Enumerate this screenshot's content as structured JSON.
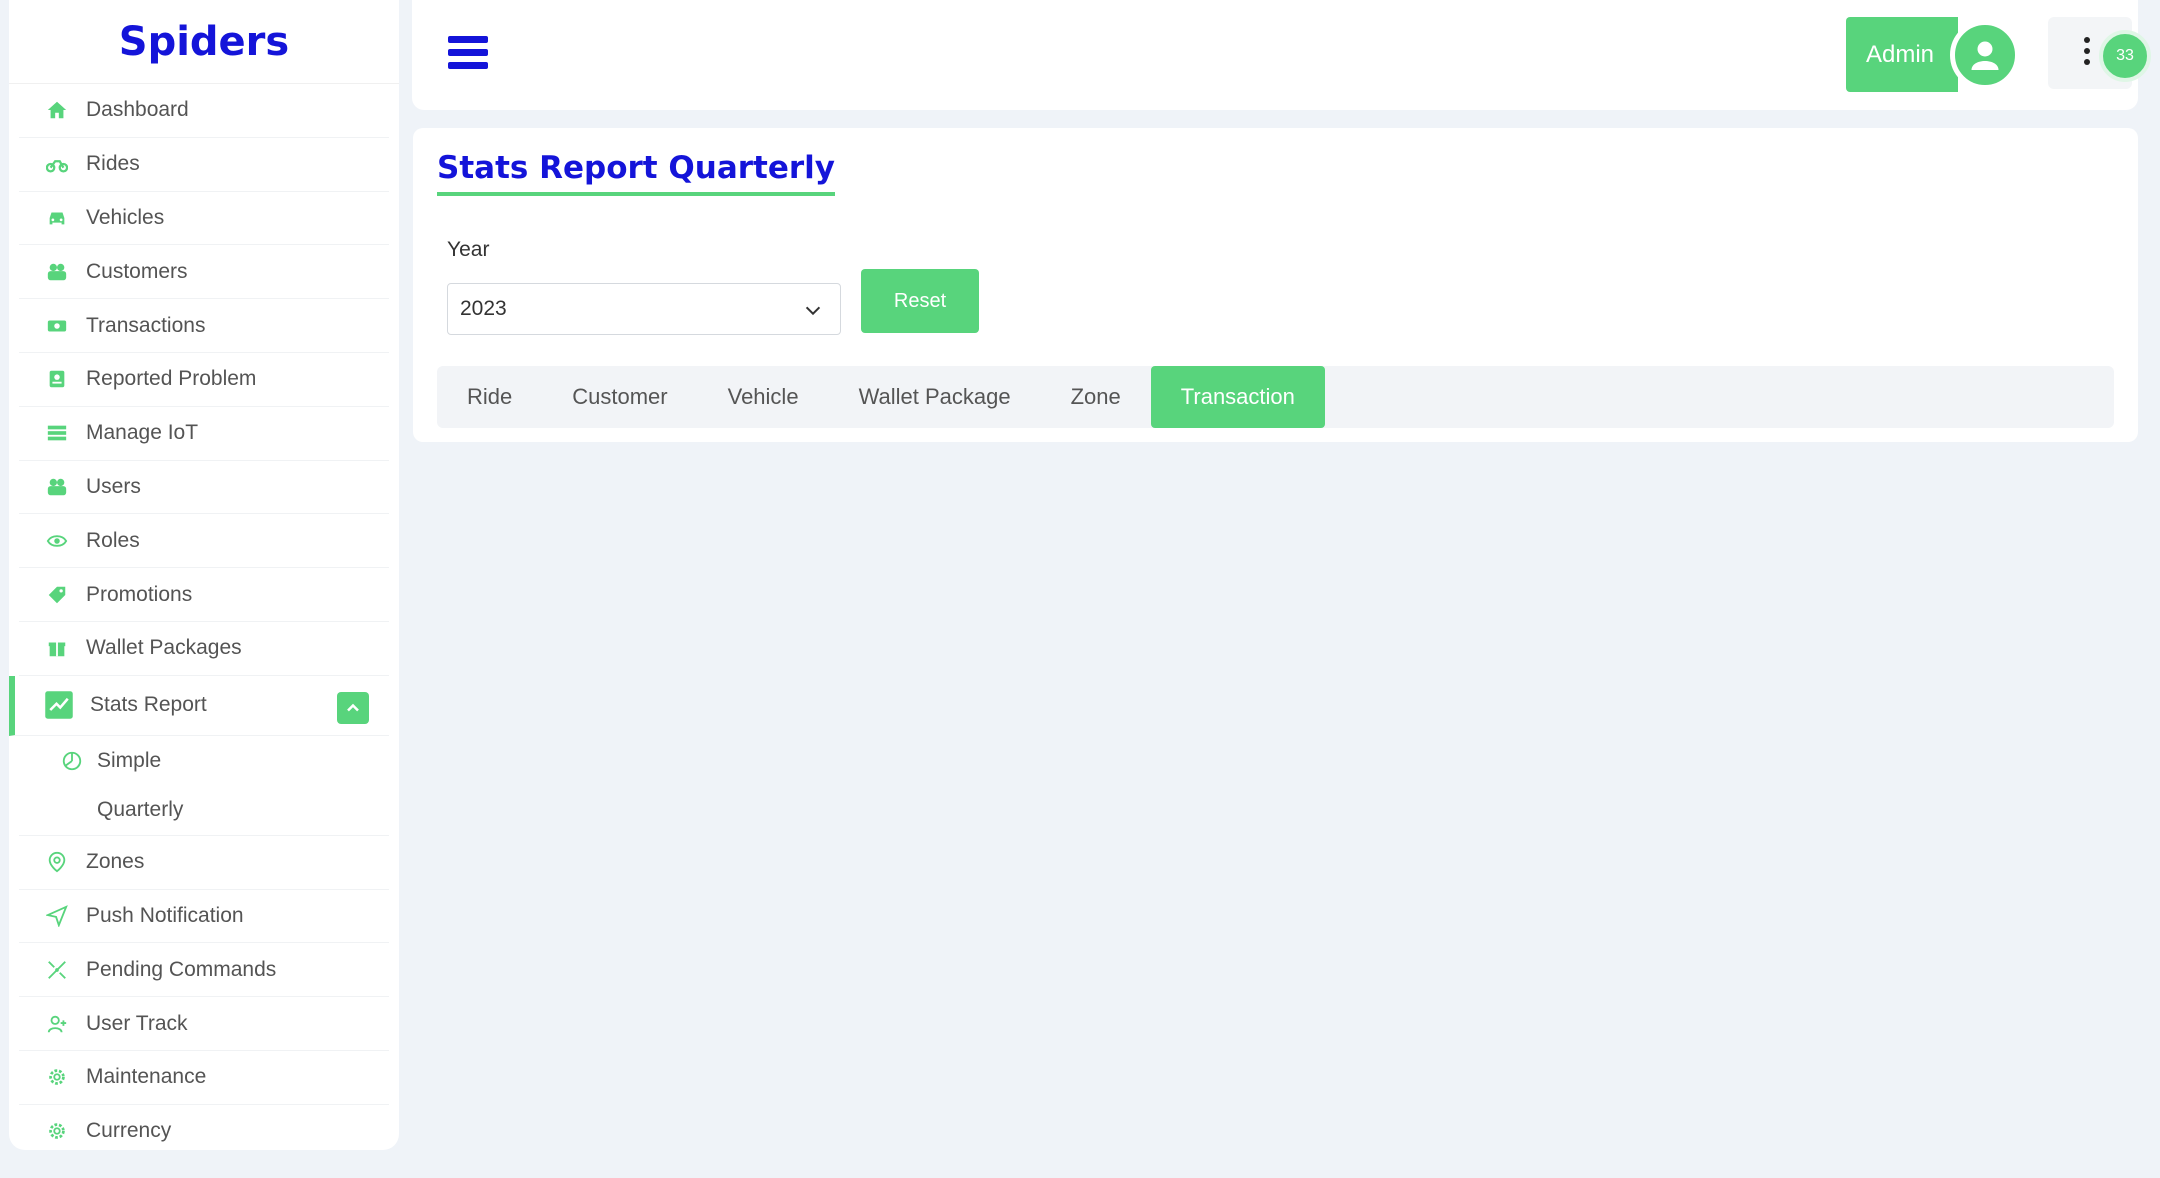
{
  "brand": "Spiders",
  "sidebar": {
    "items": [
      {
        "label": "Dashboard",
        "icon": "home-icon"
      },
      {
        "label": "Rides",
        "icon": "motorcycle-icon"
      },
      {
        "label": "Vehicles",
        "icon": "car-icon"
      },
      {
        "label": "Customers",
        "icon": "users-icon"
      },
      {
        "label": "Transactions",
        "icon": "money-icon"
      },
      {
        "label": "Reported Problem",
        "icon": "report-icon"
      },
      {
        "label": "Manage IoT",
        "icon": "list-icon"
      },
      {
        "label": "Users",
        "icon": "users-icon"
      },
      {
        "label": "Roles",
        "icon": "eye-icon"
      },
      {
        "label": "Promotions",
        "icon": "tag-icon"
      },
      {
        "label": "Wallet Packages",
        "icon": "gift-icon"
      },
      {
        "label": "Stats Report",
        "icon": "chart-icon"
      },
      {
        "label": "Simple",
        "icon": "pie-icon"
      },
      {
        "label": "Quarterly",
        "icon": ""
      },
      {
        "label": "Zones",
        "icon": "location-pin-icon"
      },
      {
        "label": "Push Notification",
        "icon": "send-icon"
      },
      {
        "label": "Pending Commands",
        "icon": "commands-icon"
      },
      {
        "label": "User Track",
        "icon": "user-track-icon"
      },
      {
        "label": "Maintenance",
        "icon": "gear-icon"
      },
      {
        "label": "Currency",
        "icon": "gear-icon"
      }
    ]
  },
  "topbar": {
    "admin_label": "Admin",
    "notification_count": "33"
  },
  "main": {
    "title": "Stats Report Quarterly",
    "year_label": "Year",
    "year_value": "2023",
    "reset_label": "Reset",
    "tabs": [
      {
        "label": "Ride",
        "active": false
      },
      {
        "label": "Customer",
        "active": false
      },
      {
        "label": "Vehicle",
        "active": false
      },
      {
        "label": "Wallet Package",
        "active": false
      },
      {
        "label": "Zone",
        "active": false
      },
      {
        "label": "Transaction",
        "active": true
      }
    ]
  },
  "colors": {
    "accent": "#58d47c",
    "brand": "#1414d9"
  }
}
